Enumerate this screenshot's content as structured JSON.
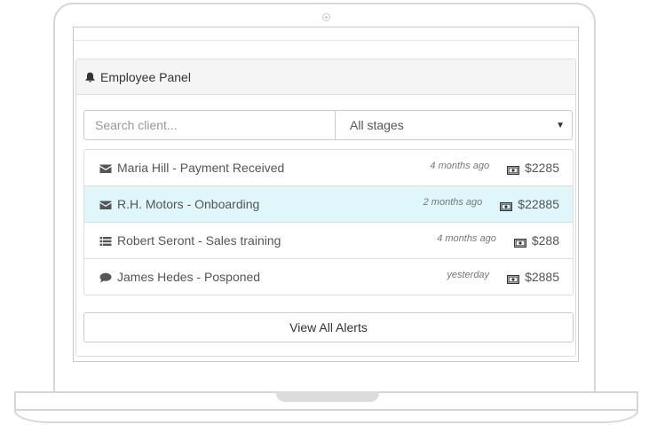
{
  "panel": {
    "title": "Employee Panel",
    "icon": "bell-icon"
  },
  "filters": {
    "search_placeholder": "Search client...",
    "stage_selected": "All stages"
  },
  "alerts": [
    {
      "icon": "envelope-icon",
      "title": "Maria Hill - Payment Received",
      "time": "4 months ago",
      "amount": "$2285",
      "active": false
    },
    {
      "icon": "envelope-icon",
      "title": "R.H. Motors - Onboarding",
      "time": "2 months ago",
      "amount": "$22885",
      "active": true
    },
    {
      "icon": "list-icon",
      "title": "Robert Seront - Sales training",
      "time": "4 months ago",
      "amount": "$288",
      "active": false
    },
    {
      "icon": "comment-icon",
      "title": "James Hedes - Posponed",
      "time": "yesterday",
      "amount": "$2885",
      "active": false
    }
  ],
  "footer": {
    "view_all_label": "View All Alerts"
  },
  "colors": {
    "active_row": "#dff6fb",
    "heading_bg": "#f5f5f5",
    "border": "#dddddd"
  }
}
